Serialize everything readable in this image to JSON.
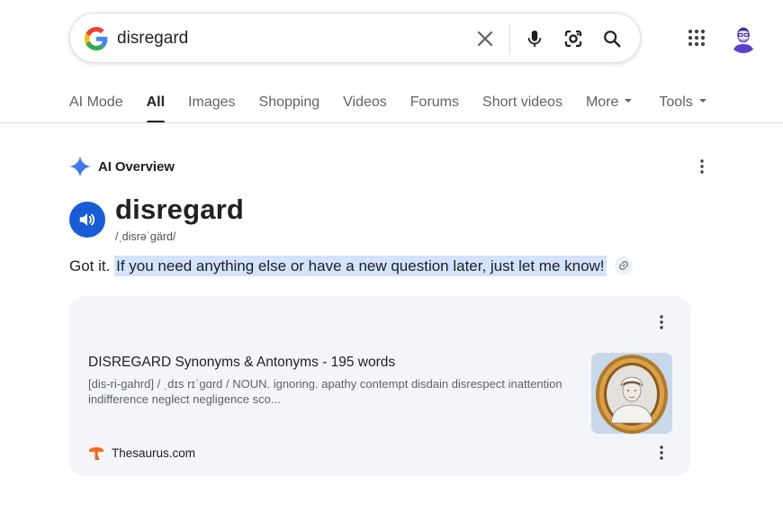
{
  "search": {
    "query": "disregard",
    "icons": [
      "google-g-icon",
      "clear-icon",
      "mic-icon",
      "lens-icon",
      "search-icon"
    ]
  },
  "header": {
    "apps_icon": "apps-grid-icon",
    "avatar": "user-avatar"
  },
  "tabs": [
    {
      "label": "AI Mode"
    },
    {
      "label": "All",
      "active": true
    },
    {
      "label": "Images"
    },
    {
      "label": "Shopping"
    },
    {
      "label": "Videos"
    },
    {
      "label": "Forums"
    },
    {
      "label": "Short videos"
    },
    {
      "label": "More",
      "dropdown": true
    },
    {
      "label": "Tools",
      "dropdown": true
    }
  ],
  "ai_overview": {
    "title": "AI Overview",
    "word": "disregard",
    "phonetic": "/ˌdisrəˈɡärd/",
    "answer_plain": "Got it.",
    "answer_highlight": "If you need anything else or have a new question later, just let me know!"
  },
  "source_card": {
    "title": "DISREGARD Synonyms & Antonyms - 195 words",
    "snippet": "[dis-ri-gahrd] / ˌdɪs rɪˈgɑrd / NOUN. ignoring. apathy contempt disdain disrespect inattention indifference neglect negligence sco...",
    "site": "Thesaurus.com"
  },
  "colors": {
    "accent_blue": "#1a5bd6",
    "highlight": "#d3e3fd",
    "card_bg": "#f3f5f8",
    "thesaurus_orange": "#f26b21"
  }
}
